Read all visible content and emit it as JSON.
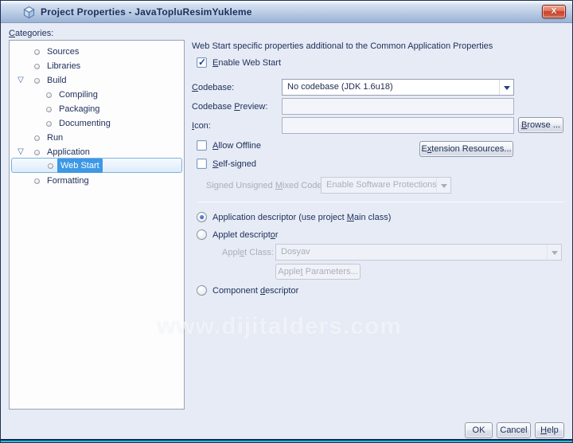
{
  "window": {
    "title": "Project Properties - JavaTopluResimYukleme",
    "title_icon": "cube-icon",
    "close_icon": "close-x-icon",
    "close_glyph": "X"
  },
  "categories": {
    "label": "Categories:",
    "items": [
      {
        "label": "Sources",
        "level": 0
      },
      {
        "label": "Libraries",
        "level": 0
      },
      {
        "label": "Build",
        "level": 0,
        "expanded": true
      },
      {
        "label": "Compiling",
        "level": 1
      },
      {
        "label": "Packaging",
        "level": 1
      },
      {
        "label": "Documenting",
        "level": 1
      },
      {
        "label": "Run",
        "level": 0
      },
      {
        "label": "Application",
        "level": 0,
        "expanded": true
      },
      {
        "label": "Web Start",
        "level": 1,
        "selected": true
      },
      {
        "label": "Formatting",
        "level": 0
      }
    ]
  },
  "panel": {
    "header": "Web Start specific properties additional to the Common Application Properties",
    "enable_web_start": {
      "label": "Enable Web Start",
      "checked": true
    },
    "codebase": {
      "label": "Codebase:",
      "value": "No codebase (JDK 1.6u18)"
    },
    "codebase_preview": {
      "label": "Codebase Preview:",
      "value": ""
    },
    "icon_field": {
      "label": "Icon:",
      "value": "",
      "browse_button": "Browse ..."
    },
    "allow_offline": {
      "label": "Allow Offline",
      "checked": false
    },
    "extension_resources_button": "Extension Resources...",
    "self_signed": {
      "label": "Self-signed",
      "checked": false
    },
    "mixed_code": {
      "label": "Signed Unsigned Mixed Code:",
      "value": "Enable Software Protections",
      "enabled": false
    },
    "descriptors": {
      "application": {
        "label": "Application descriptor (use project Main class)",
        "selected": true
      },
      "applet": {
        "label": "Applet descriptor",
        "selected": false
      },
      "applet_class": {
        "label": "Applet Class:",
        "value": "Dosyav",
        "enabled": false
      },
      "applet_parameters_button": "Applet Parameters...",
      "component": {
        "label": "Component descriptor",
        "selected": false
      }
    }
  },
  "watermark": "www.dijitalders.com",
  "footer": {
    "ok": "OK",
    "cancel": "Cancel",
    "help": "Help"
  },
  "colors": {
    "selection_blue": "#3d99e5",
    "title_text": "#1b2e5a",
    "dialog_bg": "#e6ebf5",
    "close_red": "#c8402b",
    "bottom_strip_cyan": "#28c0d6"
  }
}
